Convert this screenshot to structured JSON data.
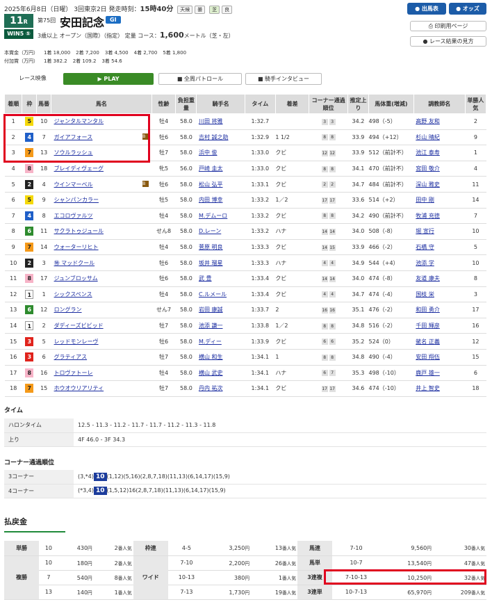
{
  "header": {
    "date": "2025年6月8日（日曜） 3回東京2日 発走時刻：",
    "start_time": "15時40分",
    "weather_label": "天候",
    "weather": "曇",
    "track_label": "芝",
    "track_cond": "良",
    "race_number": "11",
    "race_number_suffix": "R",
    "wins_label": "WIN5 ⑤",
    "edition": "第75回",
    "race_name": "安田記念",
    "grade": "GI",
    "condition": "3歳以上 オープン（国際）（指定） 定量 コース：",
    "distance": "1,600",
    "distance_unit": "メートル（芝・左）",
    "prize_label": "本賞金（万円）",
    "prize": [
      "1着 18,000",
      "2着 7,200",
      "3着 4,500",
      "4着 2,700",
      "5着 1,800"
    ],
    "addprize_label": "付加賞（万円）",
    "addprize": [
      "1着 382.2",
      "2着 109.2",
      "3着 54.6"
    ]
  },
  "buttons": {
    "entries": "● 出馬表",
    "odds": "● オッズ",
    "print": "印刷用ページ",
    "howto": "● レース結果の見方"
  },
  "video": {
    "race_video": "レース映像",
    "play": "▶ PLAY",
    "patrol": "全周パトロール",
    "interview": "騎手インタビュー"
  },
  "columns": [
    "着順",
    "枠",
    "馬番",
    "馬名",
    "性齢",
    "負担重量",
    "騎手名",
    "タイム",
    "着差",
    "コーナー通過順位",
    "推定上り",
    "馬体重(増減)",
    "調教師名",
    "単勝人気"
  ],
  "rows": [
    {
      "pos": "1",
      "frame": "5",
      "num": "10",
      "horse": "ジャンタルマンタル",
      "b": "",
      "sex": "牡4",
      "wt": "58.0",
      "jockey": "川田 将雅",
      "time": "1:32.7",
      "margin": "",
      "c1": "3",
      "c2": "3",
      "up": "34.2",
      "bw": "498（-5）",
      "trainer": "高野 友和",
      "pop": "2"
    },
    {
      "pos": "2",
      "frame": "4",
      "num": "7",
      "horse": "ガイアフォース",
      "b": "B",
      "sex": "牡6",
      "wt": "58.0",
      "jockey": "吉村 誠之助",
      "time": "1:32.9",
      "margin": "1 1/2",
      "c1": "8",
      "c2": "8",
      "up": "33.9",
      "bw": "494（+12）",
      "trainer": "杉山 晴紀",
      "pop": "9"
    },
    {
      "pos": "3",
      "frame": "7",
      "num": "13",
      "horse": "ソウルラッシュ",
      "b": "",
      "sex": "牡7",
      "wt": "58.0",
      "jockey": "浜中 俊",
      "time": "1:33.0",
      "margin": "クビ",
      "c1": "12",
      "c2": "12",
      "up": "33.9",
      "bw": "512（前計不）",
      "trainer": "池江 泰寿",
      "pop": "1"
    },
    {
      "pos": "4",
      "frame": "8",
      "num": "18",
      "horse": "ブレイディヴェーグ",
      "b": "",
      "sex": "牝5",
      "wt": "56.0",
      "jockey": "戸崎 圭太",
      "time": "1:33.0",
      "margin": "クビ",
      "c1": "8",
      "c2": "8",
      "up": "34.1",
      "bw": "470（前計不）",
      "trainer": "宮田 敬介",
      "pop": "4"
    },
    {
      "pos": "5",
      "frame": "2",
      "num": "4",
      "horse": "ウインマーベル",
      "b": "B",
      "sex": "牡6",
      "wt": "58.0",
      "jockey": "松山 弘平",
      "time": "1:33.1",
      "margin": "クビ",
      "c1": "2",
      "c2": "2",
      "up": "34.7",
      "bw": "484（前計不）",
      "trainer": "深山 雅史",
      "pop": "11"
    },
    {
      "pos": "6",
      "frame": "5",
      "num": "9",
      "horse": "シャンパンカラー",
      "b": "",
      "sex": "牡5",
      "wt": "58.0",
      "jockey": "内田 博幸",
      "time": "1:33.2",
      "margin": "1／2",
      "c1": "17",
      "c2": "17",
      "up": "33.6",
      "bw": "514（+2）",
      "trainer": "田中 剛",
      "pop": "14"
    },
    {
      "pos": "7",
      "frame": "4",
      "num": "8",
      "horse": "エコロヴァルツ",
      "b": "",
      "sex": "牡4",
      "wt": "58.0",
      "jockey": "M.デムーロ",
      "time": "1:33.2",
      "margin": "クビ",
      "c1": "8",
      "c2": "8",
      "up": "34.2",
      "bw": "490（前計不）",
      "trainer": "牧浦 充徳",
      "pop": "7"
    },
    {
      "pos": "8",
      "frame": "6",
      "num": "11",
      "horse": "サクラトゥジュール",
      "b": "",
      "sex": "せん8",
      "wt": "58.0",
      "jockey": "D.レーン",
      "time": "1:33.2",
      "margin": "ハナ",
      "c1": "14",
      "c2": "14",
      "up": "34.0",
      "bw": "508（-8）",
      "trainer": "堀 宣行",
      "pop": "10"
    },
    {
      "pos": "9",
      "frame": "7",
      "num": "14",
      "horse": "ウォーターリヒト",
      "b": "",
      "sex": "牡4",
      "wt": "58.0",
      "jockey": "菅原 明良",
      "time": "1:33.3",
      "margin": "クビ",
      "c1": "14",
      "c2": "15",
      "up": "33.9",
      "bw": "466（-2）",
      "trainer": "石橋 守",
      "pop": "5"
    },
    {
      "pos": "10",
      "frame": "2",
      "num": "3",
      "horse": "㊕ マッドクール",
      "b": "",
      "sex": "牡6",
      "wt": "58.0",
      "jockey": "坂井 瑠星",
      "time": "1:33.3",
      "margin": "ハナ",
      "c1": "4",
      "c2": "4",
      "up": "34.9",
      "bw": "544（+4）",
      "trainer": "池添 学",
      "pop": "10"
    },
    {
      "pos": "11",
      "frame": "8",
      "num": "17",
      "horse": "ジュンブロッサム",
      "b": "",
      "sex": "牡6",
      "wt": "58.0",
      "jockey": "武 豊",
      "time": "1:33.4",
      "margin": "クビ",
      "c1": "14",
      "c2": "14",
      "up": "34.0",
      "bw": "474（-8）",
      "trainer": "友道 康夫",
      "pop": "8"
    },
    {
      "pos": "12",
      "frame": "1",
      "num": "1",
      "horse": "シックスペンス",
      "b": "",
      "sex": "牡4",
      "wt": "58.0",
      "jockey": "C.ルメール",
      "time": "1:33.4",
      "margin": "クビ",
      "c1": "4",
      "c2": "4",
      "up": "34.7",
      "bw": "474（-4）",
      "trainer": "国枝 栄",
      "pop": "3"
    },
    {
      "pos": "13",
      "frame": "6",
      "num": "12",
      "horse": "ロングラン",
      "b": "",
      "sex": "せん7",
      "wt": "58.0",
      "jockey": "岩田 康誠",
      "time": "1:33.7",
      "margin": "2",
      "c1": "16",
      "c2": "16",
      "up": "35.1",
      "bw": "476（-2）",
      "trainer": "和田 勇介",
      "pop": "17"
    },
    {
      "pos": "14",
      "frame": "1",
      "num": "2",
      "horse": "ダディーズビビッド",
      "b": "",
      "sex": "牡7",
      "wt": "58.0",
      "jockey": "池添 謙一",
      "time": "1:33.8",
      "margin": "1／2",
      "c1": "8",
      "c2": "8",
      "up": "34.8",
      "bw": "516（-2）",
      "trainer": "千田 輝彦",
      "pop": "16"
    },
    {
      "pos": "15",
      "frame": "3",
      "num": "5",
      "horse": "レッドモンレーヴ",
      "b": "",
      "sex": "牡6",
      "wt": "58.0",
      "jockey": "M.ディー",
      "time": "1:33.9",
      "margin": "クビ",
      "c1": "6",
      "c2": "6",
      "up": "35.2",
      "bw": "524（0）",
      "trainer": "蛯名 正義",
      "pop": "12"
    },
    {
      "pos": "16",
      "frame": "3",
      "num": "6",
      "horse": "グラティアス",
      "b": "",
      "sex": "牡7",
      "wt": "58.0",
      "jockey": "横山 和生",
      "time": "1:34.1",
      "margin": "1",
      "c1": "8",
      "c2": "8",
      "up": "34.8",
      "bw": "490（-4）",
      "trainer": "安田 翔伍",
      "pop": "15"
    },
    {
      "pos": "17",
      "frame": "8",
      "num": "16",
      "horse": "トロヴァトーレ",
      "b": "",
      "sex": "牡4",
      "wt": "58.0",
      "jockey": "横山 武史",
      "time": "1:34.1",
      "margin": "ハナ",
      "c1": "6",
      "c2": "7",
      "up": "35.3",
      "bw": "498（-10）",
      "trainer": "鹿戸 雄一",
      "pop": "6"
    },
    {
      "pos": "18",
      "frame": "7",
      "num": "15",
      "horse": "ホウオウリアリティ",
      "b": "",
      "sex": "牡7",
      "wt": "58.0",
      "jockey": "丹内 祐次",
      "time": "1:34.1",
      "margin": "クビ",
      "c1": "17",
      "c2": "17",
      "up": "34.6",
      "bw": "474（-10）",
      "trainer": "井上 智史",
      "pop": "18"
    }
  ],
  "frame_colors": {
    "1": "#ffffff",
    "2": "#222222",
    "3": "#e0231c",
    "4": "#1f5fc8",
    "5": "#f5d90a",
    "6": "#2e8b2e",
    "7": "#f59a1a",
    "8": "#f7b4c8"
  },
  "time_section": {
    "title": "タイム",
    "halon_label": "ハロンタイム",
    "halon": "12.5 - 11.3 - 11.2 - 11.7 - 11.7 - 11.2 - 11.3 - 11.8",
    "agari_label": "上り",
    "agari": "4F 46.0 - 3F 34.3"
  },
  "corner_section": {
    "title": "コーナー通過順位",
    "c3_label": "3コーナー",
    "c3_pre": "(3,*4)",
    "c3_hl": "10",
    "c3_post": "(1,12)(5,16)(2,8,7,18)(11,13)(6,14,17)(15,9)",
    "c4_label": "4コーナー",
    "c4_pre": "(*3,4)",
    "c4_hl": "10",
    "c4_post": "(1,5,12)16(2,8,7,18)(11,13)(6,14,17)(15,9)"
  },
  "payout": {
    "title": "払戻金",
    "tansho": {
      "label": "単勝",
      "num": "10",
      "pay": "430",
      "pop": "2"
    },
    "fukusho": {
      "label": "複勝",
      "rows": [
        {
          "num": "10",
          "pay": "180",
          "pop": "2"
        },
        {
          "num": "7",
          "pay": "540",
          "pop": "8"
        },
        {
          "num": "13",
          "pay": "140",
          "pop": "1"
        }
      ]
    },
    "wakuren": {
      "label": "枠連",
      "num": "4-5",
      "pay": "3,250",
      "pop": "13"
    },
    "wide": {
      "label": "ワイド",
      "rows": [
        {
          "num": "7-10",
          "pay": "2,200",
          "pop": "26"
        },
        {
          "num": "10-13",
          "pay": "380",
          "pop": "1"
        },
        {
          "num": "7-13",
          "pay": "1,730",
          "pop": "19"
        }
      ]
    },
    "umaren": {
      "label": "馬連",
      "num": "7-10",
      "pay": "9,560",
      "pop": "30"
    },
    "umatan": {
      "label": "馬単",
      "num": "10-7",
      "pay": "13,540",
      "pop": "47"
    },
    "sanfuku": {
      "label": "3連複",
      "num": "7-10-13",
      "pay": "10,250",
      "pop": "32"
    },
    "santan": {
      "label": "3連単",
      "num": "10-7-13",
      "pay": "65,970",
      "pop": "209"
    },
    "yen": "円",
    "popsuffix": "番人気"
  }
}
